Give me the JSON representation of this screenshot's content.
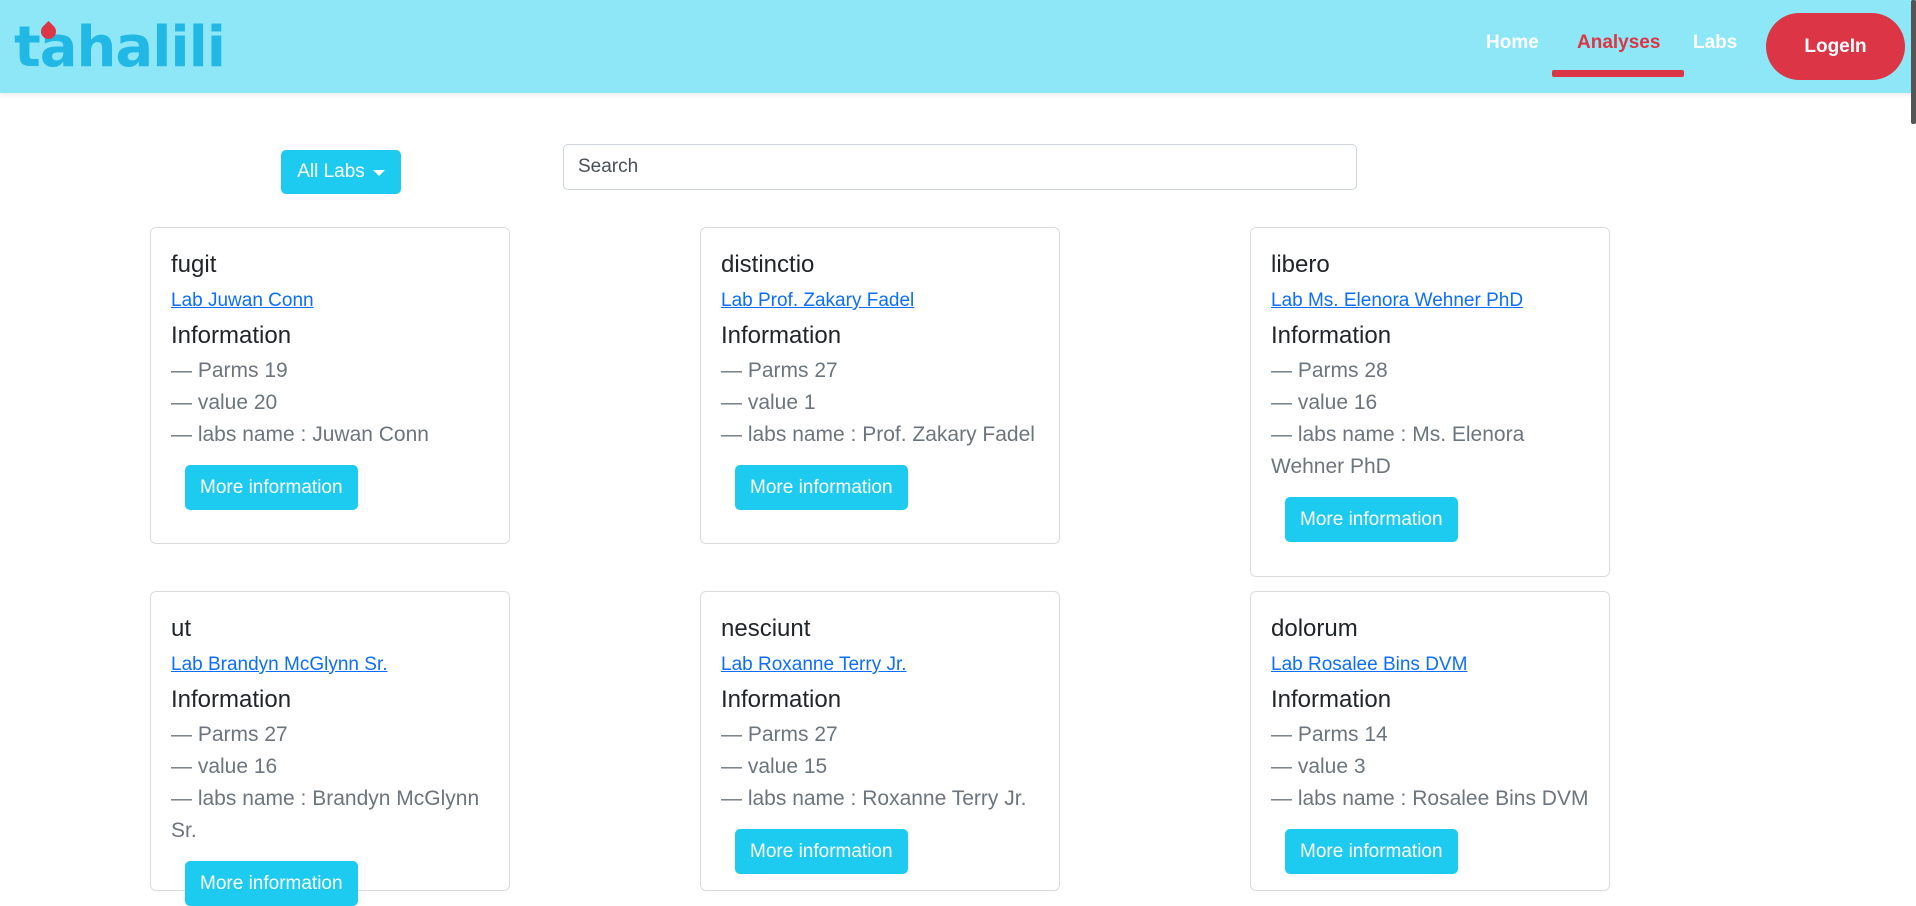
{
  "brand": {
    "logo_text": "tahalili"
  },
  "nav": {
    "home": "Home",
    "analyses": "Analyses",
    "labs": "Labs",
    "login": "LogeIn"
  },
  "toolbar": {
    "dropdown_label": "All Labs",
    "search_placeholder": "Search"
  },
  "colors": {
    "navbar": "#8ee7f6",
    "accent": "#1ccbef",
    "danger": "#dc3545",
    "link": "#0d6efd"
  },
  "cards": [
    {
      "title": "fugit",
      "lab_link": "Lab Juwan Conn",
      "info_heading": "Information",
      "parms": "— Parms 19",
      "value": "— value 20",
      "labs_name": "— labs name : Juwan Conn",
      "button": "More information"
    },
    {
      "title": "distinctio",
      "lab_link": "Lab Prof. Zakary Fadel",
      "info_heading": "Information",
      "parms": "— Parms 27",
      "value": "— value 1",
      "labs_name": "— labs name : Prof. Zakary Fadel",
      "button": "More information"
    },
    {
      "title": "libero",
      "lab_link": "Lab Ms. Elenora Wehner PhD",
      "info_heading": "Information",
      "parms": "— Parms 28",
      "value": "— value 16",
      "labs_name": "— labs name : Ms. Elenora Wehner PhD",
      "button": "More information"
    },
    {
      "title": "ut",
      "lab_link": "Lab Brandyn McGlynn Sr.",
      "info_heading": "Information",
      "parms": "— Parms 27",
      "value": "— value 16",
      "labs_name": "— labs name : Brandyn McGlynn Sr.",
      "button": "More information"
    },
    {
      "title": "nesciunt",
      "lab_link": "Lab Roxanne Terry Jr.",
      "info_heading": "Information",
      "parms": "— Parms 27",
      "value": "— value 15",
      "labs_name": "— labs name : Roxanne Terry Jr.",
      "button": "More information"
    },
    {
      "title": "dolorum",
      "lab_link": "Lab Rosalee Bins DVM",
      "info_heading": "Information",
      "parms": "— Parms 14",
      "value": "— value 3",
      "labs_name": "— labs name : Rosalee Bins DVM",
      "button": "More information"
    }
  ]
}
